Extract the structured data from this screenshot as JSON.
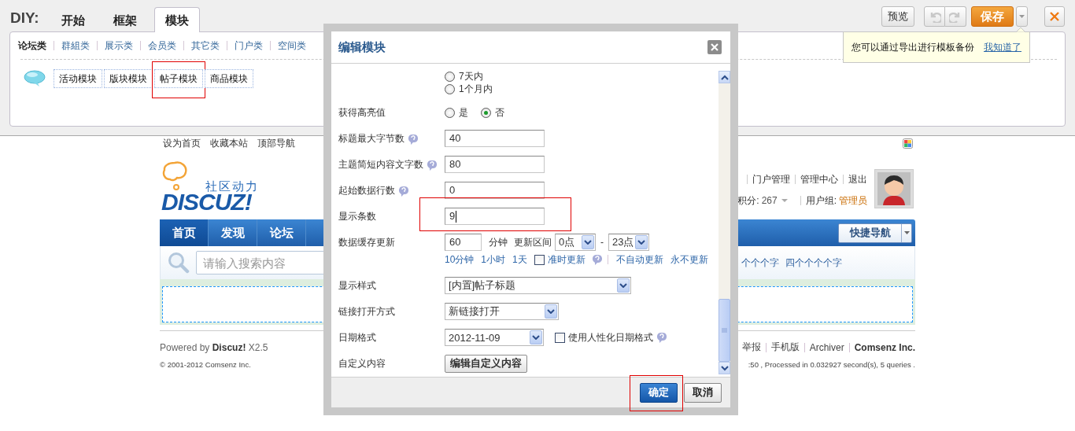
{
  "diy": {
    "label": "DIY:",
    "tabs": [
      {
        "label": "开始",
        "selected": false
      },
      {
        "label": "框架",
        "selected": false
      },
      {
        "label": "模块",
        "selected": true
      }
    ],
    "preview": "预览",
    "history": [
      {
        "kind": "undo",
        "disabled": true
      },
      {
        "kind": "redo",
        "disabled": true
      }
    ],
    "save": "保存",
    "categories": [
      {
        "label": "论坛类",
        "selected": true
      },
      {
        "label": "群組类",
        "selected": false
      },
      {
        "label": "展示类",
        "selected": false
      },
      {
        "label": "会员类",
        "selected": false
      },
      {
        "label": "其它类",
        "selected": false
      },
      {
        "label": "门户类",
        "selected": false
      },
      {
        "label": "空间类",
        "selected": false
      }
    ],
    "modules": [
      {
        "label": "活动模块",
        "highlighted": false
      },
      {
        "label": "版块模块",
        "highlighted": false
      },
      {
        "label": "帖子模块",
        "highlighted": true
      },
      {
        "label": "商品模块",
        "highlighted": false
      }
    ]
  },
  "tooltip": {
    "text": "您可以通过导出进行模板备份",
    "link": "我知道了"
  },
  "site": {
    "top_links": [
      "设为首页",
      "收藏本站",
      "顶部导航"
    ],
    "logo": {
      "tagline": "社区动力",
      "name": "DISCUZ!"
    },
    "user_links": [
      "门户管理",
      "管理中心",
      "退出"
    ],
    "credits": {
      "label": "积分:",
      "value": "267"
    },
    "group": {
      "label": "用户组:",
      "value": "管理员"
    },
    "nav": [
      {
        "label": "首页",
        "selected": true
      },
      {
        "label": "发现",
        "selected": false
      },
      {
        "label": "论坛",
        "selected": false
      }
    ],
    "quick_nav": "快捷导航",
    "search": {
      "placeholder": "请输入搜索内容"
    },
    "hot_words": [
      "个个个字",
      "四个个个个字"
    ],
    "powered": "Powered by **Discuz!** X2.5",
    "copyright": "© 2001-2012 Comsenz Inc.",
    "footer_links": [
      {
        "label": "举报",
        "bold": false
      },
      {
        "label": "手机版",
        "bold": false
      },
      {
        "label": "Archiver",
        "bold": false
      },
      {
        "label": "Comsenz Inc.",
        "bold": true
      }
    ],
    "stats": ":50 , Processed in 0.032927 second(s), 5 queries ."
  },
  "dialog": {
    "title": "编辑模块",
    "rows": [
      {
        "kind": "radio_stack",
        "options": [
          {
            "label": "7天内",
            "selected": false
          },
          {
            "label": "1个月内",
            "selected": false
          }
        ]
      },
      {
        "kind": "radios",
        "label": "获得高亮值",
        "options": [
          {
            "label": "是",
            "selected": false
          },
          {
            "label": "否",
            "selected": true
          }
        ]
      },
      {
        "kind": "text",
        "label": "标题最大字节数",
        "help": true,
        "value": "40",
        "focused": false,
        "highlighted": false
      },
      {
        "kind": "text",
        "label": "主题简短内容文字数",
        "help": true,
        "value": "80",
        "focused": false,
        "highlighted": false
      },
      {
        "kind": "text",
        "label": "起始数据行数",
        "help": true,
        "value": "0",
        "focused": false,
        "highlighted": false
      },
      {
        "kind": "text",
        "label": "显示条数",
        "help": false,
        "value": "9",
        "focused": true,
        "highlighted": true
      },
      {
        "kind": "cache",
        "label": "数据缓存更新",
        "value": "60",
        "unit": "分钟",
        "range_label": "更新区间",
        "from": "0点",
        "dash": "-",
        "to": "23点",
        "presets": [
          "10分钟",
          "1小时",
          "1天"
        ],
        "on_time": {
          "label": "准时更新",
          "checked": false
        },
        "links": [
          "不自动更新",
          "永不更新"
        ]
      },
      {
        "kind": "select",
        "label": "显示样式",
        "value": "[内置]帖子标题"
      },
      {
        "kind": "select",
        "label": "链接打开方式",
        "value": "新链接打开"
      },
      {
        "kind": "date",
        "label": "日期格式",
        "value": "2012-11-09",
        "humanize": {
          "label": "使用人性化日期格式",
          "checked": false
        }
      },
      {
        "kind": "button",
        "label": "自定义内容",
        "button": "编辑自定义内容"
      }
    ],
    "buttons": [
      {
        "label": "确定",
        "primary": true,
        "highlighted": true
      },
      {
        "label": "取消",
        "primary": false,
        "highlighted": false
      }
    ]
  }
}
